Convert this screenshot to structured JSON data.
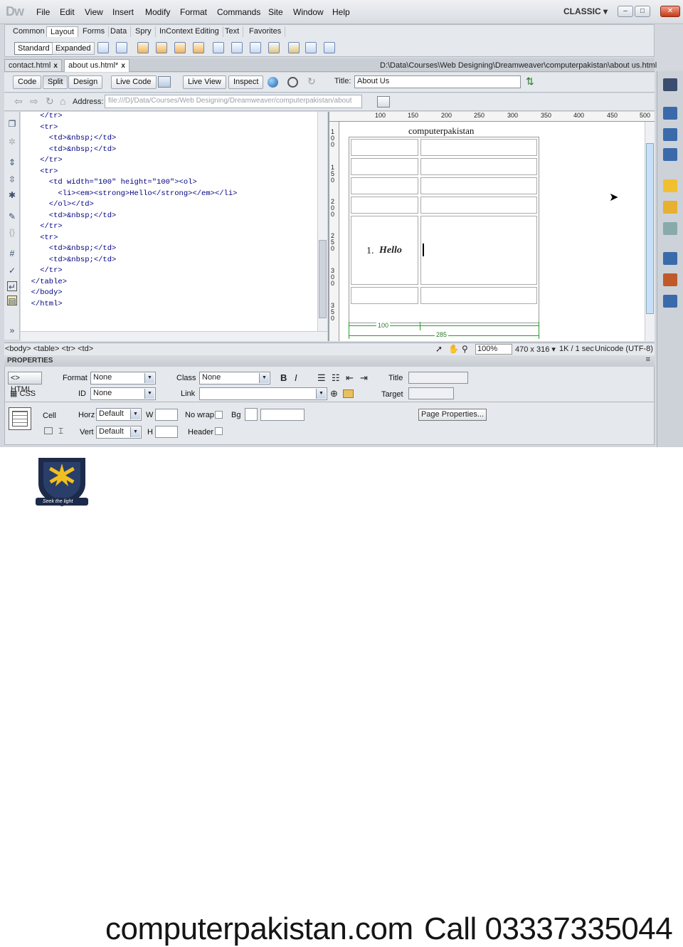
{
  "app": {
    "logo": "Dw",
    "workspace": "CLASSIC ▾",
    "window_buttons": [
      "–",
      "□",
      "✕"
    ]
  },
  "menu": [
    "File",
    "Edit",
    "View",
    "Insert",
    "Modify",
    "Format",
    "Commands",
    "Site",
    "Window",
    "Help"
  ],
  "insert_bar": {
    "tabs": [
      "Common",
      "Layout",
      "Forms",
      "Data",
      "Spry",
      "InContext Editing",
      "Text",
      "Favorites"
    ],
    "active_tab": "Layout",
    "modes": [
      "Standard",
      "Expanded"
    ]
  },
  "doc_tabs": [
    {
      "label": "contact.html",
      "close": "x"
    },
    {
      "label": "about us.html*",
      "close": "x"
    }
  ],
  "doc_path": "D:\\Data\\Courses\\Web Designing\\Dreamweaver\\computerpakistan\\about us.html",
  "view_bar": {
    "code": "Code",
    "split": "Split",
    "design": "Design",
    "live_code": "Live Code",
    "live_view": "Live View",
    "inspect": "Inspect",
    "title_label": "Title:",
    "title_value": "About Us"
  },
  "address_bar": {
    "label": "Address:",
    "value": "file:///D|/Data/Courses/Web Designing/Dreamweaver/computerpakistan/about"
  },
  "code_lines": [
    "    </tr>",
    "    <tr>",
    "      <td>&nbsp;</td>",
    "      <td>&nbsp;</td>",
    "    </tr>",
    "    <tr>",
    "      <td width=\"100\" height=\"100\"><ol>",
    "        <li><em><strong>Hello</strong></em></li>",
    "      </ol></td>",
    "      <td>&nbsp;</td>",
    "    </tr>",
    "    <tr>",
    "      <td>&nbsp;</td>",
    "      <td>&nbsp;</td>",
    "    </tr>",
    "  </table>",
    "  </body>",
    "  </html>"
  ],
  "design": {
    "heading": "computerpakistan",
    "list_num": "1.",
    "list_text": "Hello",
    "width_a": "100",
    "width_b": "285",
    "ruler_h": [
      "100",
      "150",
      "200",
      "250",
      "300",
      "350",
      "400",
      "450",
      "500"
    ],
    "ruler_v": [
      "1 0 0",
      "1 5 0",
      "2 0 0",
      "2 5 0",
      "3 0 0",
      "3 5 0"
    ]
  },
  "status": {
    "tags": "<body> <table> <tr> <td>",
    "zoom": "100%",
    "size": "470 x 316 ▾",
    "weight": "1K / 1 sec",
    "encoding": "Unicode (UTF-8)"
  },
  "properties": {
    "title": "PROPERTIES",
    "html_btn": "HTML",
    "css_btn": "CSS",
    "format_label": "Format",
    "format_value": "None",
    "id_label": "ID",
    "id_value": "None",
    "class_label": "Class",
    "class_value": "None",
    "link_label": "Link",
    "title_label": "Title",
    "target_label": "Target",
    "cell_label": "Cell",
    "horz_label": "Horz",
    "horz_value": "Default",
    "vert_label": "Vert",
    "vert_value": "Default",
    "w_label": "W",
    "h_label": "H",
    "nowrap_label": "No wrap",
    "bg_label": "Bg",
    "header_label": "Header",
    "page_props": "Page Properties..."
  },
  "footer": {
    "site": "computerpakistan.com",
    "call": "Call 03337335044",
    "motto": "Seek the light"
  }
}
